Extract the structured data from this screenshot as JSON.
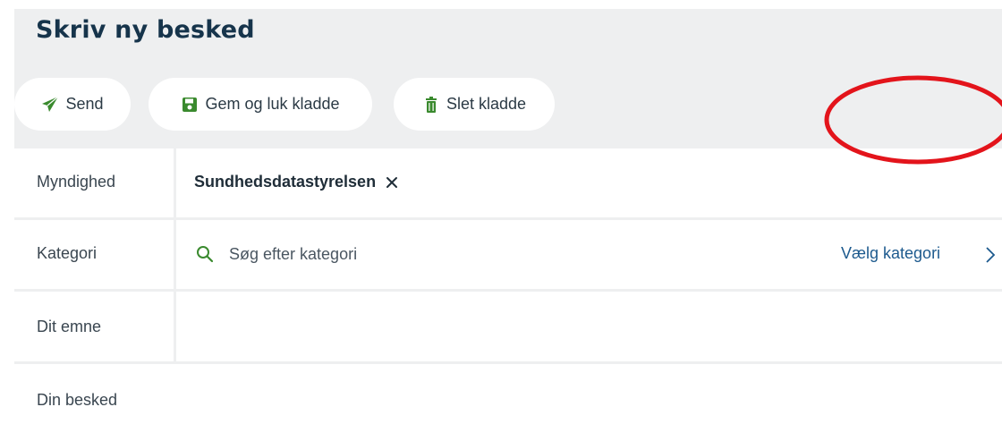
{
  "page": {
    "title": "Skriv ny besked"
  },
  "toolbar": {
    "send_label": "Send",
    "save_label": "Gem og luk kladde",
    "delete_label": "Slet kladde"
  },
  "form": {
    "authority": {
      "label": "Myndighed",
      "value": "Sundhedsdatastyrelsen"
    },
    "category": {
      "label": "Kategori",
      "placeholder": "Søg efter kategori",
      "choose_label": "Vælg kategori"
    },
    "subject": {
      "label": "Dit emne"
    },
    "message": {
      "label": "Din besked"
    }
  },
  "colors": {
    "title": "#16344b",
    "accent_green": "#3a8a2e",
    "link_blue": "#1d5a8e",
    "highlight_red": "#e3141b",
    "panel_gray": "#eeeff0"
  },
  "icons": {
    "send": "paper-plane-icon",
    "save": "floppy-disk-icon",
    "delete": "trash-icon",
    "remove": "close-icon",
    "search": "search-icon",
    "chevron": "chevron-right-icon"
  }
}
